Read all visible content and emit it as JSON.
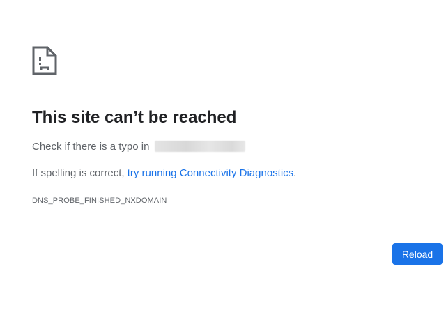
{
  "page": {
    "icon": "sad-page-icon",
    "title": "This site can’t be reached",
    "typo_prefix": "Check if there is a typo in",
    "spelling_prefix": "If spelling is correct,",
    "diagnostics_link": "try running Connectivity Diagnostics",
    "diagnostics_suffix": ".",
    "error_code": "DNS_PROBE_FINISHED_NXDOMAIN",
    "reload_label": "Reload"
  },
  "colors": {
    "link": "#1a73e8",
    "button": "#1a73e8",
    "title": "#202124",
    "body_text": "#5f6368"
  }
}
